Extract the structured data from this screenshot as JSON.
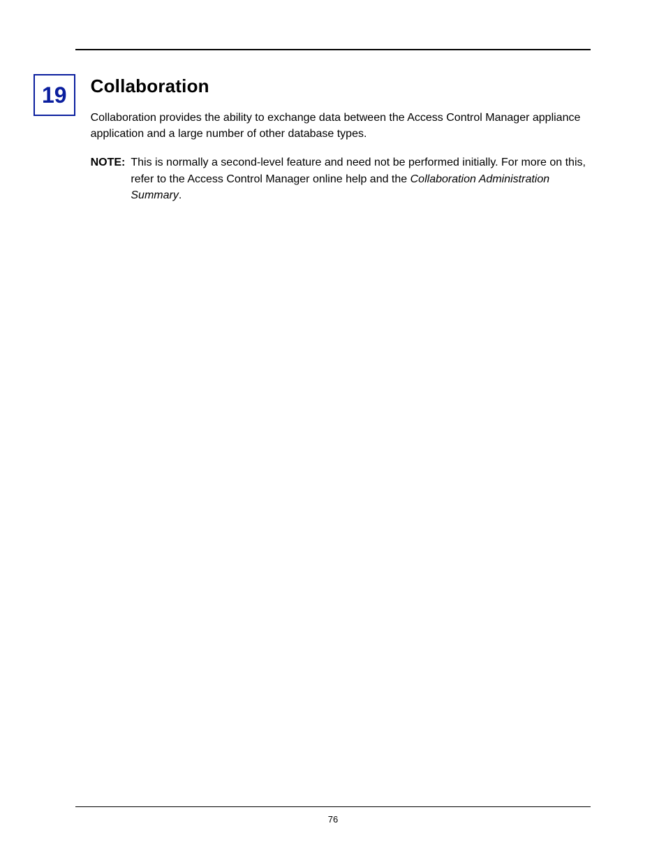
{
  "chapter": {
    "number": "19"
  },
  "heading": {
    "title": "Collaboration"
  },
  "body": {
    "lead": "Collaboration provides the ability to exchange data between the Access Control Manager appliance application and a large number of other database types."
  },
  "note": {
    "label": "NOTE:",
    "pre": "This is normally a second-level feature and need not be performed initially. For more on this, refer to the Access Control Manager online help and the ",
    "italic": "Collaboration Administration Summary",
    "post": "."
  },
  "footer": {
    "page_number": "76"
  }
}
